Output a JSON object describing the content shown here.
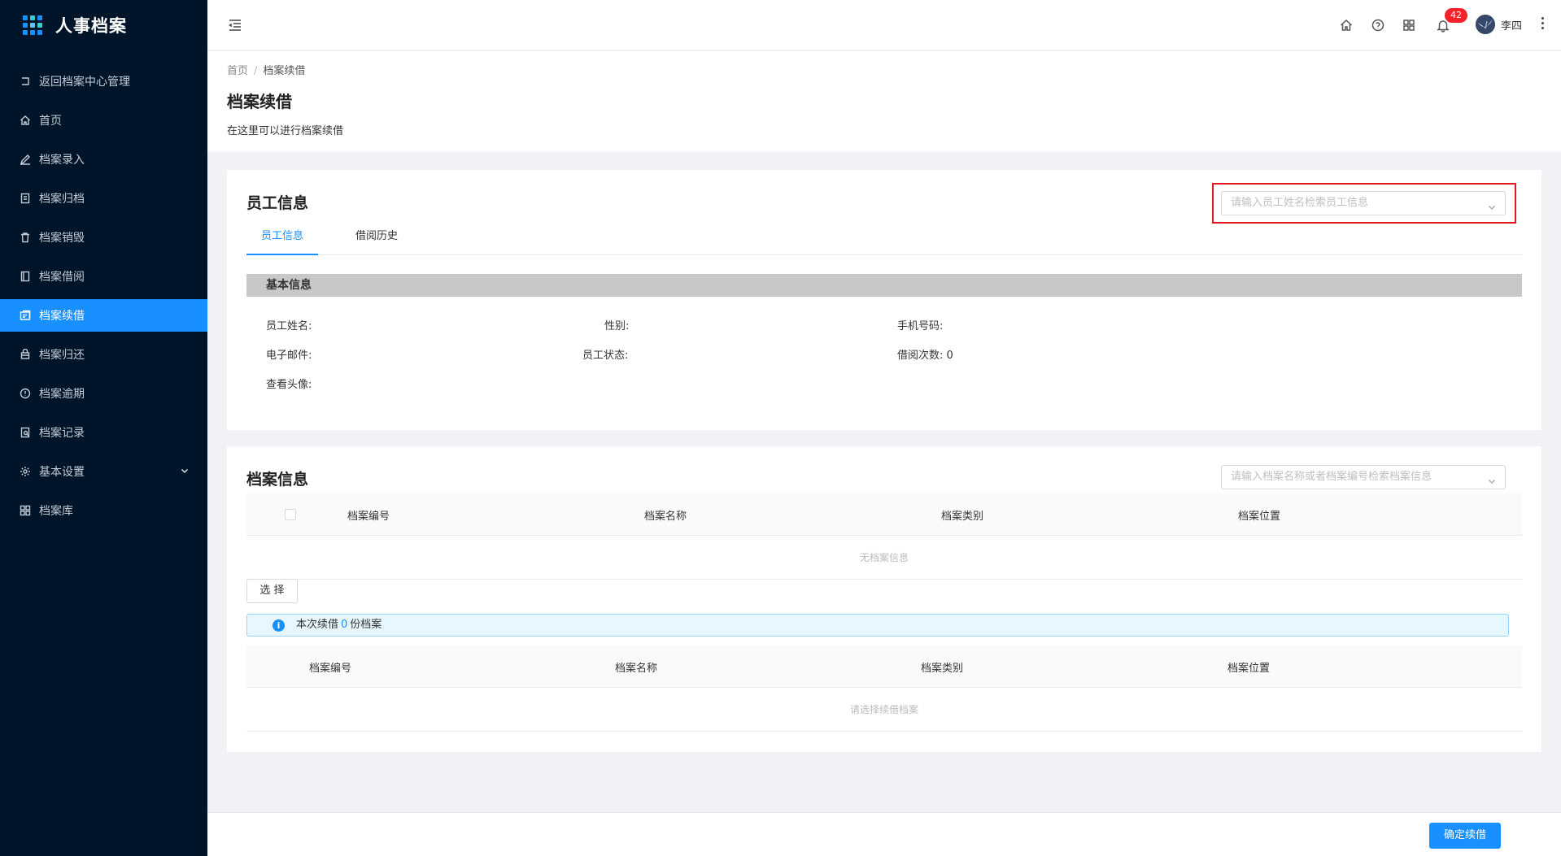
{
  "app": {
    "title": "人事档案"
  },
  "sidebar": {
    "items": [
      {
        "label": "返回档案中心管理",
        "icon": "back-icon"
      },
      {
        "label": "首页",
        "icon": "home-icon"
      },
      {
        "label": "档案录入",
        "icon": "edit-icon"
      },
      {
        "label": "档案归档",
        "icon": "archive-icon"
      },
      {
        "label": "档案销毁",
        "icon": "trash-icon"
      },
      {
        "label": "档案借阅",
        "icon": "book-icon"
      },
      {
        "label": "档案续借",
        "icon": "renew-icon",
        "active": true
      },
      {
        "label": "档案归还",
        "icon": "return-icon"
      },
      {
        "label": "档案逾期",
        "icon": "alert-circle-icon"
      },
      {
        "label": "档案记录",
        "icon": "record-icon"
      },
      {
        "label": "基本设置",
        "icon": "gear-icon"
      },
      {
        "label": "档案库",
        "icon": "apps-icon"
      }
    ]
  },
  "header": {
    "notification_count": "42",
    "username": "李四"
  },
  "page": {
    "breadcrumb": {
      "home": "首页",
      "separator": "/",
      "current": "档案续借"
    },
    "title": "档案续借",
    "description": "在这里可以进行档案续借"
  },
  "employee_card": {
    "title": "员工信息",
    "search_placeholder": "请输入员工姓名检索员工信息",
    "tabs": [
      "员工信息",
      "借阅历史"
    ],
    "section_title": "基本信息",
    "fields": {
      "name": "员工姓名:",
      "gender": "性别:",
      "phone": "手机号码:",
      "email": "电子邮件:",
      "status": "员工状态:",
      "borrow_count_label": "借阅次数:",
      "borrow_count_value": "0",
      "avatar": "查看头像:"
    }
  },
  "archive_card": {
    "title": "档案信息",
    "search_placeholder": "请输入档案名称或者档案编号检索档案信息",
    "columns": [
      "档案编号",
      "档案名称",
      "档案类别",
      "档案位置"
    ],
    "empty_text": "无档案信息",
    "select_button": "选 择",
    "alert": {
      "prefix": "本次续借",
      "count": "0",
      "suffix": "份档案"
    },
    "selected_columns": [
      "档案编号",
      "档案名称",
      "档案类别",
      "档案位置"
    ],
    "selected_empty_text": "请选择续借档案"
  },
  "footer": {
    "confirm_button": "确定续借"
  },
  "colors": {
    "primary": "#1890ff",
    "sidebar_bg": "#001529",
    "badge": "#f5222d",
    "highlight_box": "#e8151b"
  }
}
